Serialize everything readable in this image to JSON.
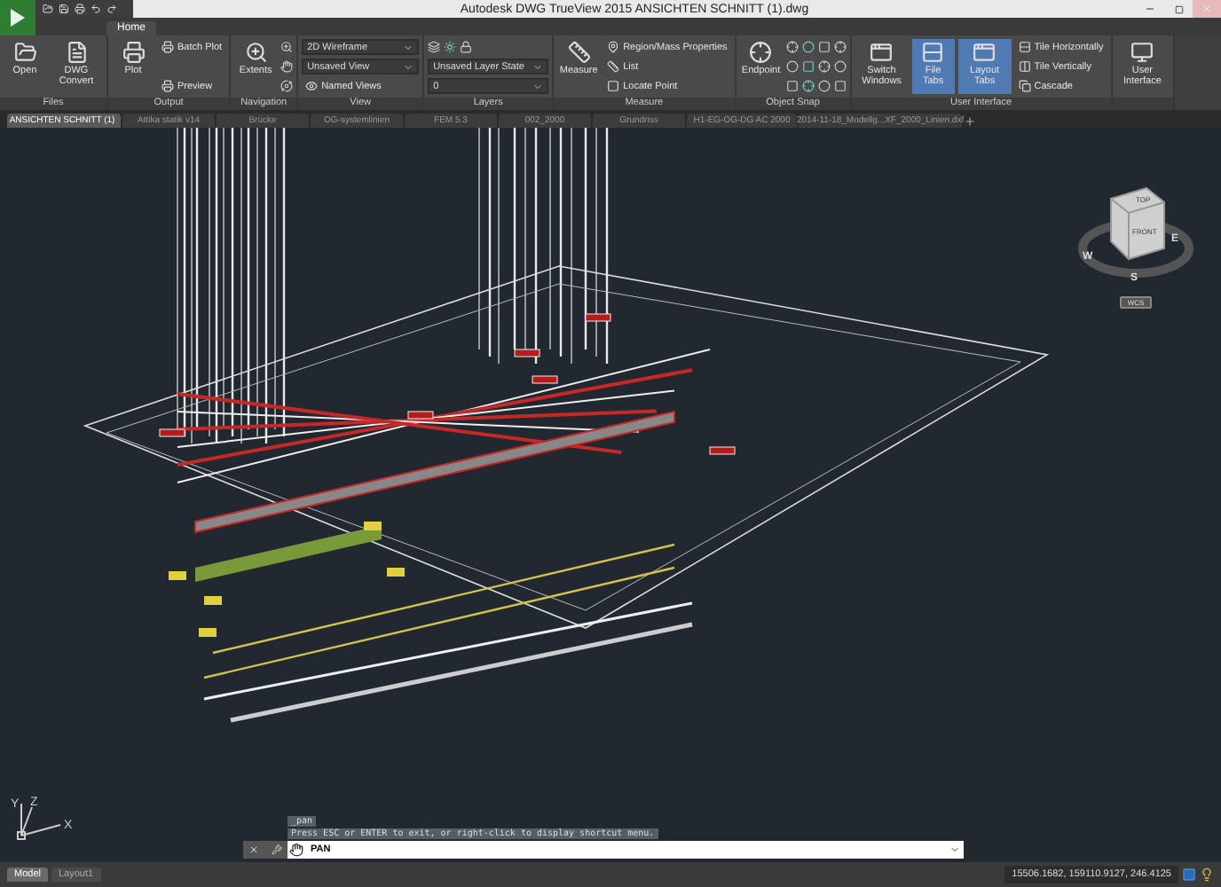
{
  "window": {
    "app_title": "Autodesk DWG TrueView 2015",
    "document_title": "ANSICHTEN SCHNITT (1).dwg"
  },
  "ribbon_tabs": [
    {
      "label": "Home",
      "selected": true
    }
  ],
  "ribbon_panels": [
    {
      "title": "Files",
      "columns": [
        [
          {
            "kind": "large",
            "label": "Open"
          }
        ],
        [
          {
            "kind": "large",
            "label": "DWG Convert"
          }
        ]
      ]
    },
    {
      "title": "Output",
      "columns": [
        [
          {
            "kind": "large",
            "label": "Plot"
          }
        ],
        [
          {
            "kind": "small",
            "label": "Batch Plot"
          },
          {
            "kind": "small",
            "label": "Preview"
          }
        ]
      ]
    },
    {
      "title": "Navigation",
      "columns": [
        [
          {
            "kind": "large",
            "label": "Extents"
          }
        ],
        [
          {
            "kind": "icon"
          },
          {
            "kind": "icon"
          },
          {
            "kind": "icon"
          }
        ]
      ]
    },
    {
      "title": "View",
      "columns": [
        [
          {
            "kind": "dropdown",
            "label": "2D Wireframe"
          },
          {
            "kind": "dropdown",
            "label": "Unsaved View"
          },
          {
            "kind": "small",
            "label": "Named Views"
          }
        ]
      ]
    },
    {
      "title": "Layers",
      "columns": [
        [
          {
            "kind": "icons"
          },
          {
            "kind": "dropdown",
            "label": "Unsaved Layer State"
          },
          {
            "kind": "dropdown",
            "label": "0"
          }
        ]
      ]
    },
    {
      "title": "Measure",
      "columns": [
        [
          {
            "kind": "large",
            "label": "Measure"
          }
        ],
        [
          {
            "kind": "small",
            "label": "Region/Mass Properties"
          },
          {
            "kind": "small",
            "label": "List"
          },
          {
            "kind": "small",
            "label": "Locate Point"
          }
        ]
      ]
    },
    {
      "title": "Object Snap",
      "columns": [
        [
          {
            "kind": "large",
            "label": "Endpoint"
          }
        ],
        [
          {
            "kind": "icons"
          },
          {
            "kind": "icons"
          },
          {
            "kind": "icons"
          }
        ],
        [
          {
            "kind": "icon"
          },
          {
            "kind": "icon"
          },
          {
            "kind": "icon"
          }
        ]
      ]
    },
    {
      "title": "User Interface",
      "columns": [
        [
          {
            "kind": "large",
            "label": "Switch Windows",
            "on": false
          }
        ],
        [
          {
            "kind": "large",
            "label": "File Tabs",
            "on": true
          }
        ],
        [
          {
            "kind": "large",
            "label": "Layout Tabs",
            "on": true
          }
        ],
        [
          {
            "kind": "small",
            "label": "Tile Horizontally",
            "on": false
          },
          {
            "kind": "small",
            "label": "Tile Vertically",
            "on": false
          },
          {
            "kind": "small",
            "label": "Cascade",
            "on": false
          }
        ]
      ]
    },
    {
      "columns": [
        [
          {
            "kind": "large",
            "label": "User Interface"
          }
        ]
      ]
    }
  ],
  "file_tabs": [
    {
      "label": "ANSICHTEN SCHNITT (1)",
      "selected": true
    },
    {
      "label": "Attika statik v14",
      "selected": false
    },
    {
      "label": "Brücke",
      "selected": false
    },
    {
      "label": "OG-systemlinien",
      "selected": false
    },
    {
      "label": "FEM 5.3",
      "selected": false
    },
    {
      "label": "002_2000",
      "selected": false
    },
    {
      "label": "Grundriss",
      "selected": false
    },
    {
      "label": "H1-EG-OG-DG AC 2000",
      "selected": false
    },
    {
      "label": "2014-11-18_Modellg...XF_2000_Linien.dxf",
      "selected": false
    }
  ],
  "viewcube": {
    "top": "TOP",
    "front": "FRONT",
    "compass": [
      "W",
      "S",
      "E"
    ],
    "ucs_button": "WCS"
  },
  "ucs_icon": {
    "axes": [
      "Y",
      "Z",
      "X"
    ]
  },
  "command_line": {
    "history": [
      "_pan",
      "Press ESC or ENTER to exit, or right-click to display shortcut menu."
    ],
    "value": "PAN"
  },
  "layout_tabs": [
    {
      "label": "Model",
      "selected": true
    },
    {
      "label": "Layout1",
      "selected": false
    }
  ],
  "status_bar": {
    "coordinates": "15506.1682, 159110.9127, 246.4125"
  }
}
